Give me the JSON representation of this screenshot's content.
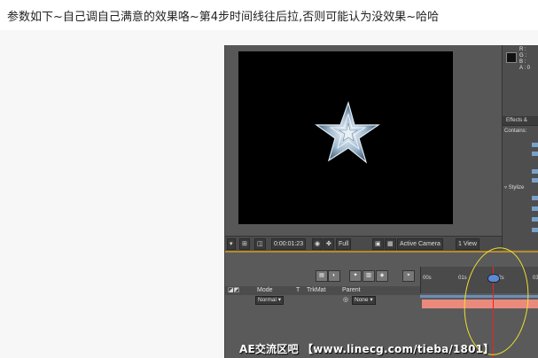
{
  "post": {
    "caption": "参数如下~自己调自己满意的效果咯~第4步时间线往后拉,否则可能认为没效果~哈哈"
  },
  "screenshot": {
    "info_panel": {
      "r_label": "R :",
      "g_label": "G :",
      "b_label": "B :",
      "a_label": "A : 0"
    },
    "effects_panel": {
      "tab_label": "Effects &",
      "contains_label": "Contains:",
      "stylize_label": "Stylize"
    },
    "viewer_toolbar": {
      "timecode": "0:00:01:23",
      "resolution": "Full",
      "camera": "Active Camera",
      "view": "1 View"
    },
    "timeline": {
      "columns": {
        "mode": "Mode",
        "t": "T",
        "trkmat": "TrkMat",
        "parent": "Parent"
      },
      "layer": {
        "mode_value": "Normal",
        "parent_value": "None"
      },
      "ruler": {
        "ticks": [
          "00s",
          "01s",
          "02s",
          "03"
        ]
      }
    },
    "watermark": "AE交流区吧 【www.linecg.com/tieba/1801】",
    "colors": {
      "star": "#c8dcec",
      "playhead": "#e22222",
      "annotation": "#f0e030",
      "layer_bar": "#e98a7d"
    }
  }
}
